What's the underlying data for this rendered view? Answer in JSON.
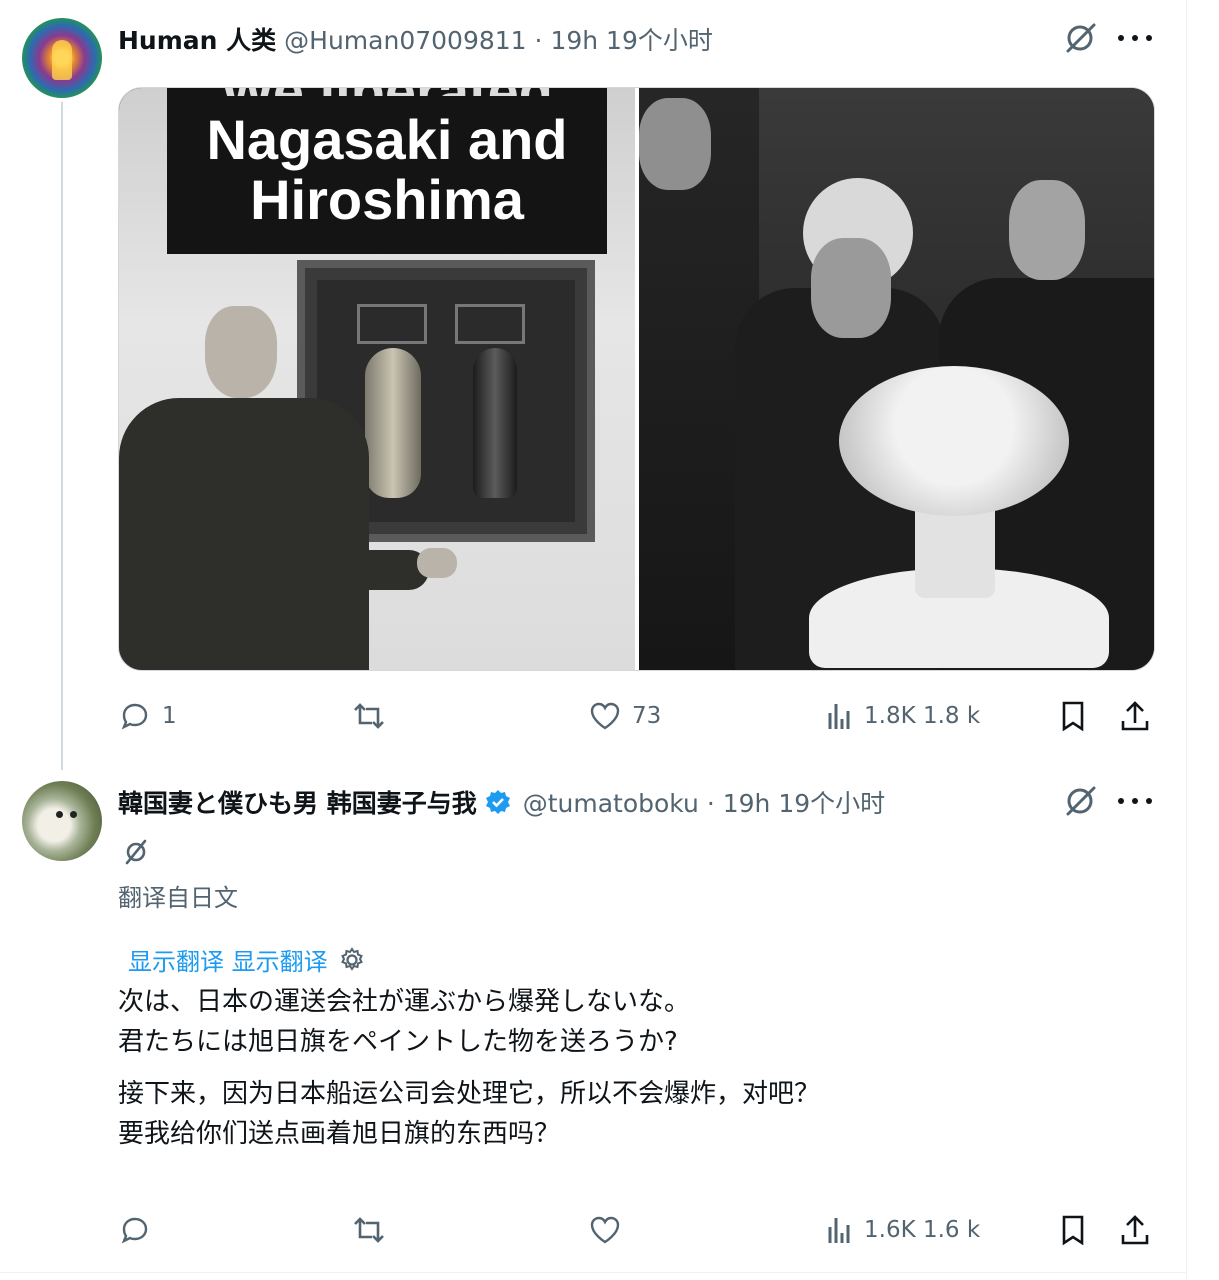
{
  "tweet1": {
    "display_name": "Human 人类",
    "handle": "@Human07009811",
    "dot": "·",
    "time": "19h 19个小时",
    "image_sign": {
      "line0": "We liberated",
      "line1": "Nagasaki and",
      "line2": "Hiroshima"
    },
    "reply_count": "1",
    "retweet_count": "",
    "like_count": "73",
    "views": "1.8K 1.8 k"
  },
  "tweet2": {
    "display_name": "韓国妻と僕ひも男 韩国妻子与我",
    "handle": "@tumatoboku",
    "dot": "·",
    "time": "19h 19个小时",
    "translated_from": "翻译自日文",
    "show_translation": "显示翻译 显示翻译",
    "original_text": "次は、日本の運送会社が運ぶから爆発しないな。\n君たちには旭日旗をペイントした物を送ろうか?",
    "translated_text": "接下来，因为日本船运公司会处理它，所以不会爆炸，对吧？\n要我给你们送点画着旭日旗的东西吗？",
    "reply_count": "",
    "retweet_count": "",
    "like_count": "",
    "views": "1.6K 1.6 k"
  },
  "icons": {
    "grok": "grok-icon",
    "more": "more-icon",
    "reply": "reply-icon",
    "retweet": "retweet-icon",
    "like": "heart-icon",
    "views": "views-icon",
    "bookmark": "bookmark-icon",
    "share": "share-icon",
    "verified": "verified-badge-icon",
    "settings": "gear-icon"
  },
  "colors": {
    "link": "#1d9bf0",
    "muted": "#536471",
    "text": "#0f1419",
    "verified": "#1d9bf0"
  }
}
